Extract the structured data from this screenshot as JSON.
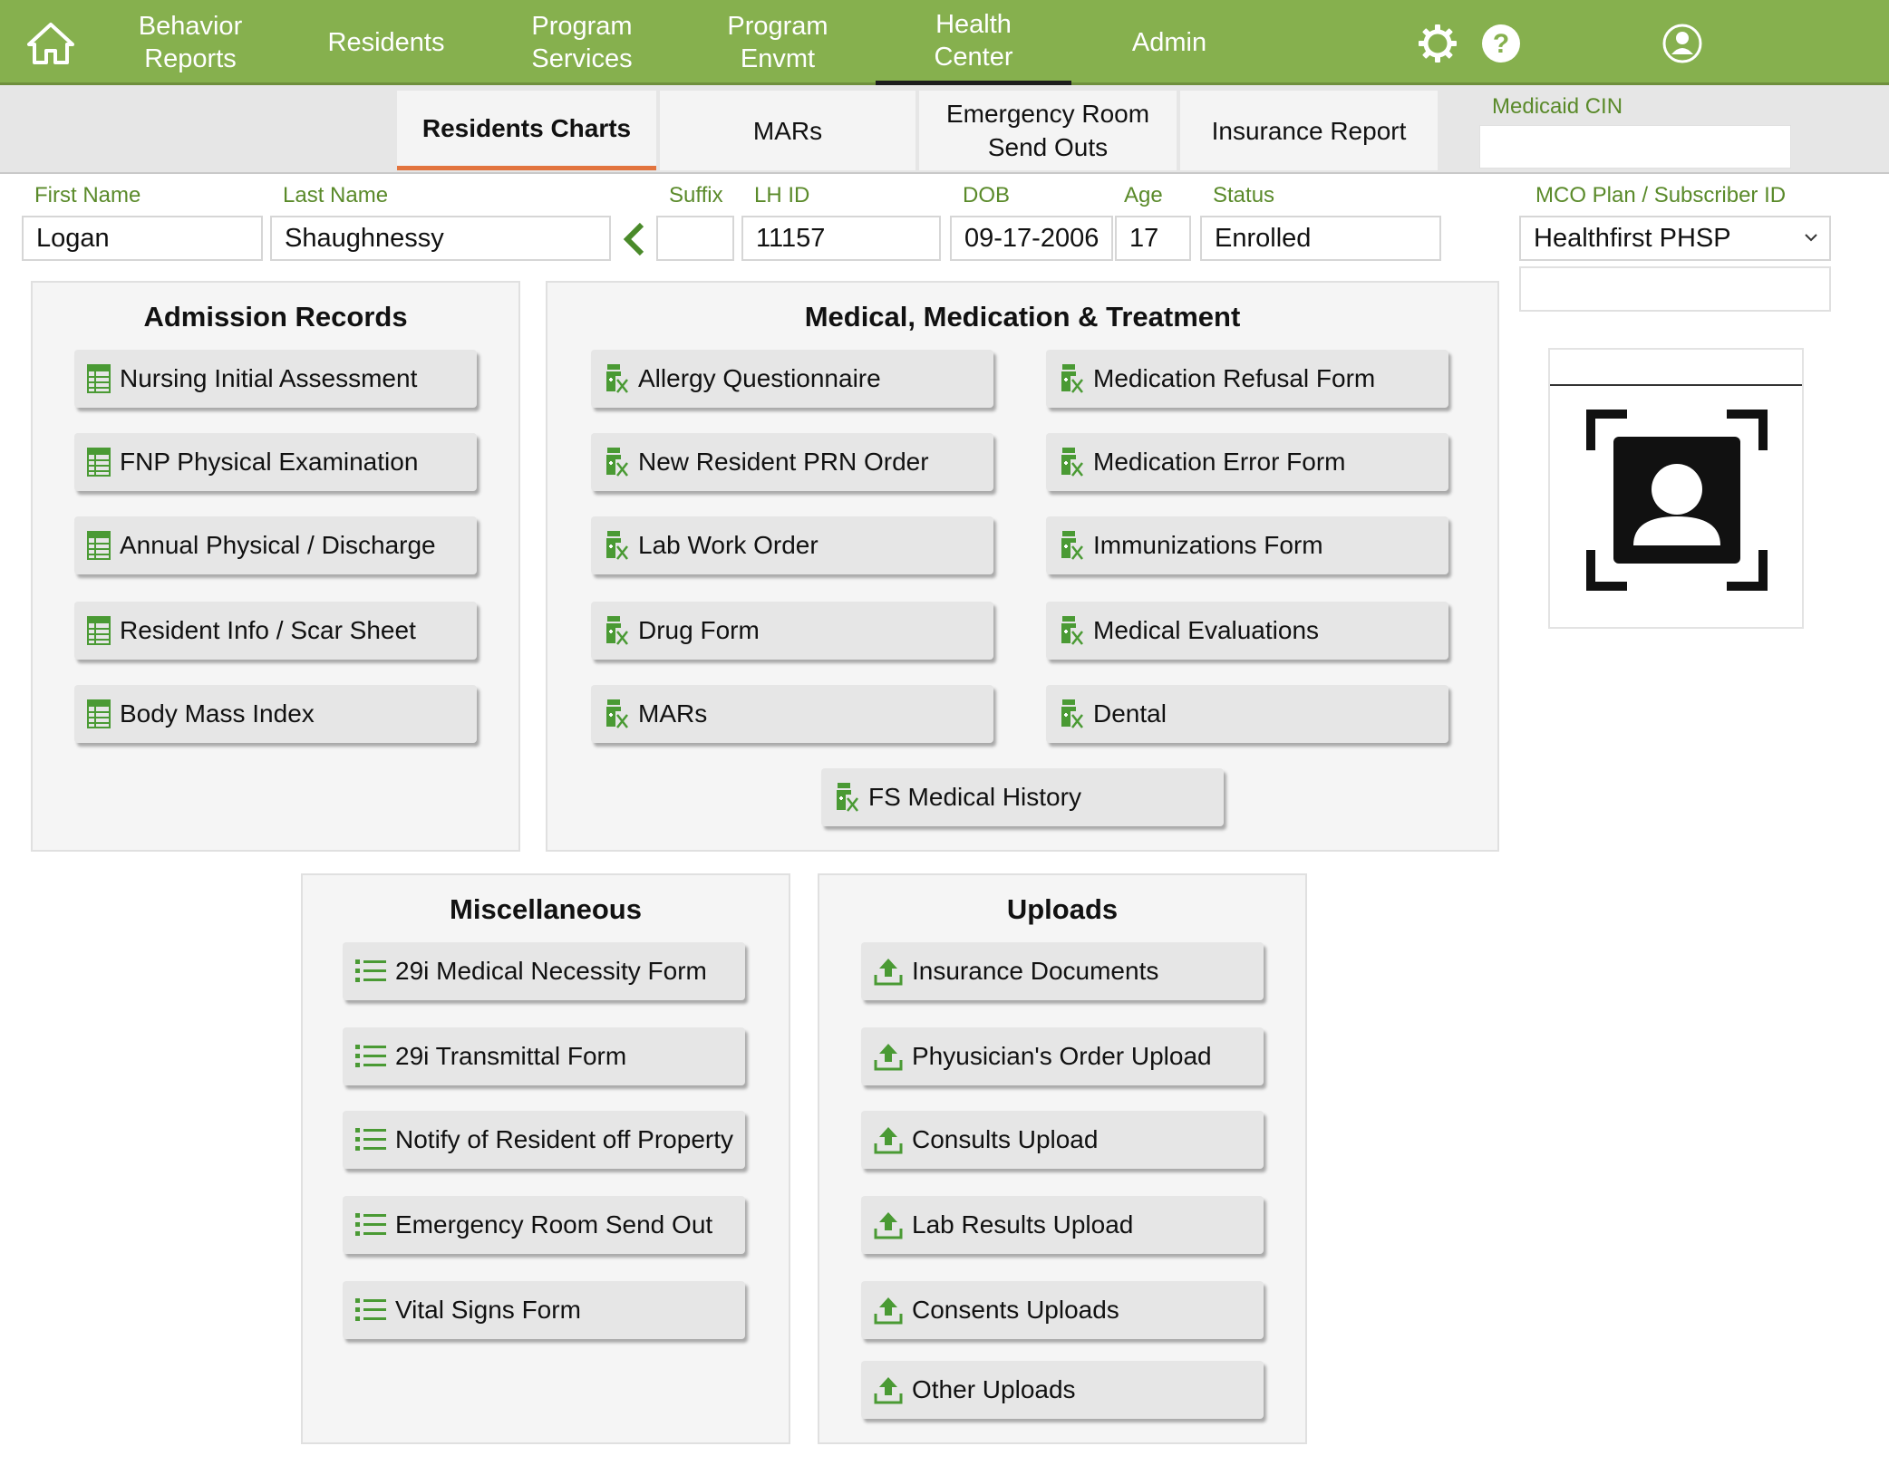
{
  "nav": {
    "items": [
      {
        "label": "Behavior\nReports"
      },
      {
        "label": "Residents"
      },
      {
        "label": "Program\nServices"
      },
      {
        "label": "Program\nEnvmt"
      },
      {
        "label": "Health\nCenter"
      },
      {
        "label": "Admin"
      }
    ],
    "active": "Health Center"
  },
  "subtabs": {
    "items": [
      {
        "label": "Residents Charts"
      },
      {
        "label": "MARs"
      },
      {
        "label": "Emergency Room\nSend Outs"
      },
      {
        "label": "Insurance Report"
      }
    ],
    "medicaid_label": "Medicaid CIN",
    "medicaid_value": ""
  },
  "resident": {
    "first_name_label": "First Name",
    "first_name": "Logan",
    "last_name_label": "Last Name",
    "last_name": "Shaughnessy",
    "suffix_label": "Suffix",
    "suffix": "",
    "lhid_label": "LH ID",
    "lhid": "11157",
    "dob_label": "DOB",
    "dob": "09-17-2006",
    "age_label": "Age",
    "age": "17",
    "status_label": "Status",
    "status": "Enrolled",
    "mco_label": "MCO Plan / Subscriber ID",
    "mco_plan": "Healthfirst PHSP",
    "subscriber_id": ""
  },
  "admission": {
    "title": "Admission Records",
    "buttons": [
      "Nursing Initial Assessment",
      "FNP Physical Examination",
      "Annual Physical / Discharge",
      "Resident Info / Scar Sheet",
      "Body Mass Index"
    ]
  },
  "medical": {
    "title": "Medical, Medication & Treatment",
    "left": [
      "Allergy Questionnaire",
      "New Resident PRN Order",
      "Lab Work Order",
      "Drug Form",
      "MARs"
    ],
    "right": [
      "Medication Refusal Form",
      "Medication Error Form",
      "Immunizations Form",
      "Medical Evaluations",
      "Dental"
    ],
    "bottom": "FS Medical History"
  },
  "misc": {
    "title": "Miscellaneous",
    "buttons": [
      "29i Medical Necessity Form",
      "29i Transmittal Form",
      "Notify of Resident off Property",
      "Emergency Room Send Out",
      "Vital Signs Form"
    ]
  },
  "uploads": {
    "title": "Uploads",
    "buttons": [
      "Insurance Documents",
      "Phyusician's Order Upload",
      "Consults Upload",
      "Lab Results Upload",
      "Consents Uploads",
      "Other Uploads"
    ]
  },
  "icons": {
    "home": "home-icon",
    "settings": "gear-icon",
    "help": "help-icon",
    "user": "user-account-icon",
    "back": "chevron-left-icon",
    "admission_btn": "spreadsheet-icon",
    "medical_btn": "medicine-bottle-icon",
    "misc_btn": "list-icon",
    "upload_btn": "upload-icon",
    "photo": "resident-photo-placeholder-icon"
  },
  "colors": {
    "nav_green": "#86b04e",
    "label_green": "#5a8a2a",
    "icon_green": "#4a9a34",
    "active_tab_underline": "#e2743e"
  }
}
